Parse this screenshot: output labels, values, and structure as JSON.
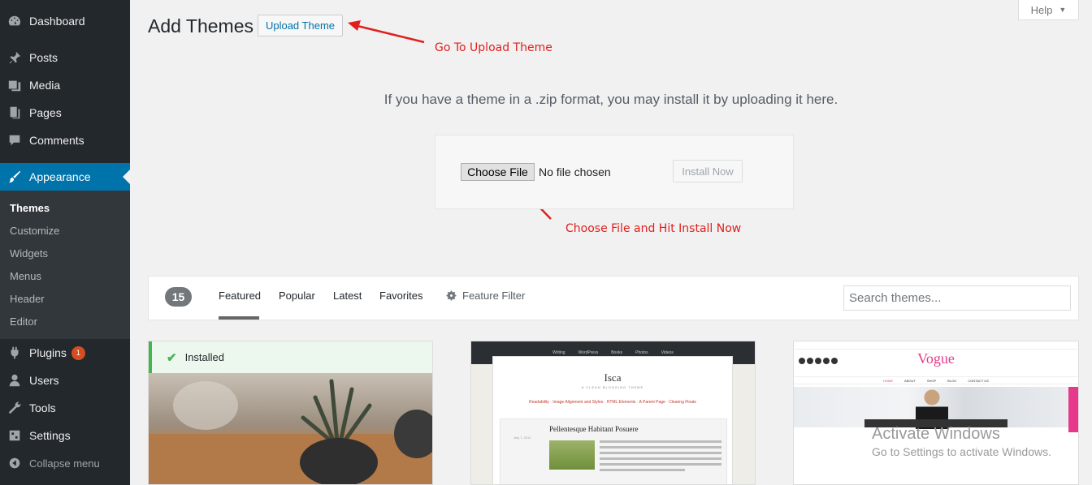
{
  "sidebar": {
    "items": [
      {
        "label": "Dashboard",
        "icon": "dashboard-icon"
      },
      {
        "label": "Posts",
        "icon": "pin-icon"
      },
      {
        "label": "Media",
        "icon": "media-icon"
      },
      {
        "label": "Pages",
        "icon": "pages-icon"
      },
      {
        "label": "Comments",
        "icon": "comment-icon"
      },
      {
        "label": "Appearance",
        "icon": "brush-icon",
        "active": true
      },
      {
        "label": "Plugins",
        "icon": "plugin-icon",
        "badge": "1"
      },
      {
        "label": "Users",
        "icon": "user-icon"
      },
      {
        "label": "Tools",
        "icon": "wrench-icon"
      },
      {
        "label": "Settings",
        "icon": "settings-icon"
      },
      {
        "label": "Collapse menu",
        "icon": "collapse-icon"
      }
    ],
    "submenu": [
      "Themes",
      "Customize",
      "Widgets",
      "Menus",
      "Header",
      "Editor"
    ],
    "current_submenu": "Themes"
  },
  "header": {
    "title": "Add Themes",
    "upload_button": "Upload Theme",
    "help": "Help"
  },
  "annotations": {
    "upload": "Go To Upload Theme",
    "choose": "Choose File and Hit Install Now"
  },
  "upload": {
    "description": "If you have a theme in a .zip format, you may install it by uploading it here.",
    "choose_file": "Choose File",
    "no_file": "No file chosen",
    "install_now": "Install Now"
  },
  "filters": {
    "count": "15",
    "tabs": [
      "Featured",
      "Popular",
      "Latest",
      "Favorites"
    ],
    "active_tab": "Featured",
    "feature_filter": "Feature Filter",
    "search_placeholder": "Search themes..."
  },
  "themes": {
    "installed_label": "Installed",
    "isca": {
      "title": "Isca",
      "tagline": "A CLEAN BLOGGING THEME",
      "nav": [
        "Writing",
        "WordPress",
        "Books",
        "Photos",
        "Videos"
      ],
      "subnav": "Readability · Image Alignment and Styles · HTML Elements · A Parent Page · Clearing Floats",
      "post_title": "Pellentesque Habitant Posuere",
      "date": "July 7, 2011"
    },
    "vogue": {
      "title": "Vogue",
      "menu": [
        "HOME",
        "ABOUT",
        "SHOP",
        "BLOG",
        "CONTACT US"
      ]
    }
  },
  "watermark": {
    "line1": "Activate Windows",
    "line2": "Go to Settings to activate Windows."
  },
  "colors": {
    "sidebar": "#23282d",
    "accent": "#0073aa",
    "annotation": "#e0201c",
    "installed": "#46b450"
  }
}
